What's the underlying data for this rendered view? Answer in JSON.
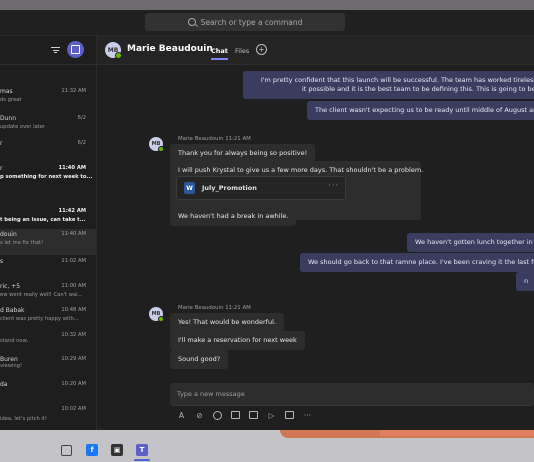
{
  "search": {
    "placeholder": "Search or type a command"
  },
  "sidebar": {
    "conversations": [
      {
        "name": "mas",
        "preview": "ds great",
        "time": "11:32 AM",
        "bold": false
      },
      {
        "name": "Dunn",
        "preview": "update over later",
        "time": "6/2",
        "bold": false
      },
      {
        "name": "r",
        "preview": "",
        "time": "6/2",
        "bold": false
      },
      {
        "name": "r",
        "preview": "p something for next week to...",
        "time": "11:40 AM",
        "bold": true
      },
      {
        "name": "",
        "preview": "t being an issue, can take t...",
        "time": "11:42 AM",
        "bold": true
      },
      {
        "name": "douin",
        "preview": "s let me fix that!",
        "time": "11:40 AM",
        "bold": false,
        "active": true
      },
      {
        "name": "s",
        "preview": "",
        "time": "11:02 AM",
        "bold": false
      },
      {
        "name": "ric, +5",
        "preview": "ew went really well! Can't wai...",
        "time": "11:00 AM",
        "bold": false
      },
      {
        "name": "d Babak",
        "preview": "client was pretty happy with...",
        "time": "10:48 AM",
        "bold": false
      },
      {
        "name": "stand now.",
        "preview": "",
        "time": "10:32 AM",
        "bold": false
      },
      {
        "name": "Buren",
        "preview": "viewing!",
        "time": "10:29 AM",
        "bold": false
      },
      {
        "name": "da",
        "preview": "",
        "time": "10:20 AM",
        "bold": false
      },
      {
        "name": "idea, let's pitch it!",
        "preview": "",
        "time": "10:02 AM",
        "bold": false
      }
    ]
  },
  "header": {
    "avatar_initials": "MB",
    "name": "Marie Beaudouin",
    "tabs": [
      "Chat",
      "Files"
    ]
  },
  "messages": {
    "mine_1_line1": "I'm pretty confident that this launch will be successful. The team has worked tirelessly to",
    "mine_1_line2": "it possible and it is the best team to be defining this. This is going to be awe",
    "mine_2": "The client wasn't expecting us to be ready until middle of August an",
    "them_meta_1": "Marie Beaudouin   11:21 AM",
    "them_1": "Thank you for always being so positive!",
    "them_2": "I will push Krystal to give us a few more days. That shouldn't be a problem.",
    "attachment": "July_Promotion",
    "attachment_icon": "W",
    "them_3": "We haven't had a break in awhile.",
    "mine_3": "We haven't gotten lunch together in a",
    "mine_4": "We should go back to that ramne place. I've been craving it the last few",
    "mine_5": "n",
    "them_meta_2": "Marie Beaudouin   11:21 AM",
    "them_4": "Yes! That would be wonderful.",
    "them_5": "I'll make a reservation for next week",
    "them_6": "Sound good?"
  },
  "compose": {
    "placeholder": "Type a new message"
  },
  "colors": {
    "accent": "#5b5fc7",
    "my_bubble": "#3b3d5e",
    "their_bubble": "#2d2d2d",
    "presence": "#6bb700"
  }
}
